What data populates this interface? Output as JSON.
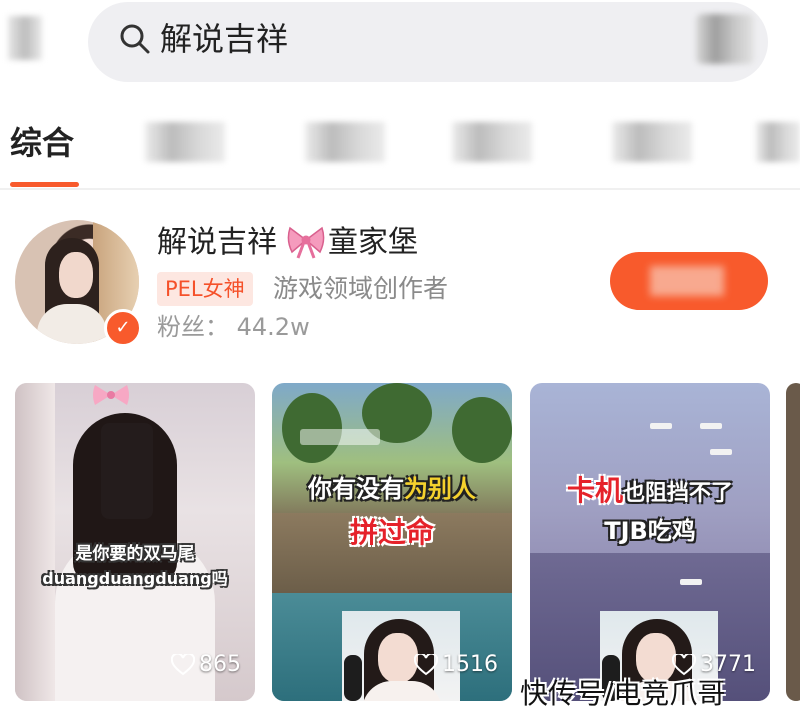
{
  "search": {
    "query": "解说吉祥"
  },
  "tabs": [
    {
      "label": "综合",
      "active": true
    }
  ],
  "profile": {
    "name_prefix": "解说吉祥",
    "name_suffix": "童家堡",
    "name_icon": "bow-icon",
    "tag": "PEL女神",
    "role": "游戏领域创作者",
    "fans": "粉丝： 44.2w",
    "verified_icon": "check-icon"
  },
  "videos": [
    {
      "caption1": "是你要的双马尾",
      "caption2": "duangduangduang吗",
      "likes": "865"
    },
    {
      "title_a": "你有没有",
      "title_b": "为别人",
      "title_line2": "拼过命",
      "likes": "1516"
    },
    {
      "title_a": "卡机",
      "title_b": "也阻挡不了",
      "title_line2": "TJB吃鸡",
      "likes": "3771"
    }
  ],
  "watermark": "快传号/电竞爪哥",
  "colors": {
    "accent": "#f85a2c",
    "tag_bg": "#fde7e1"
  }
}
